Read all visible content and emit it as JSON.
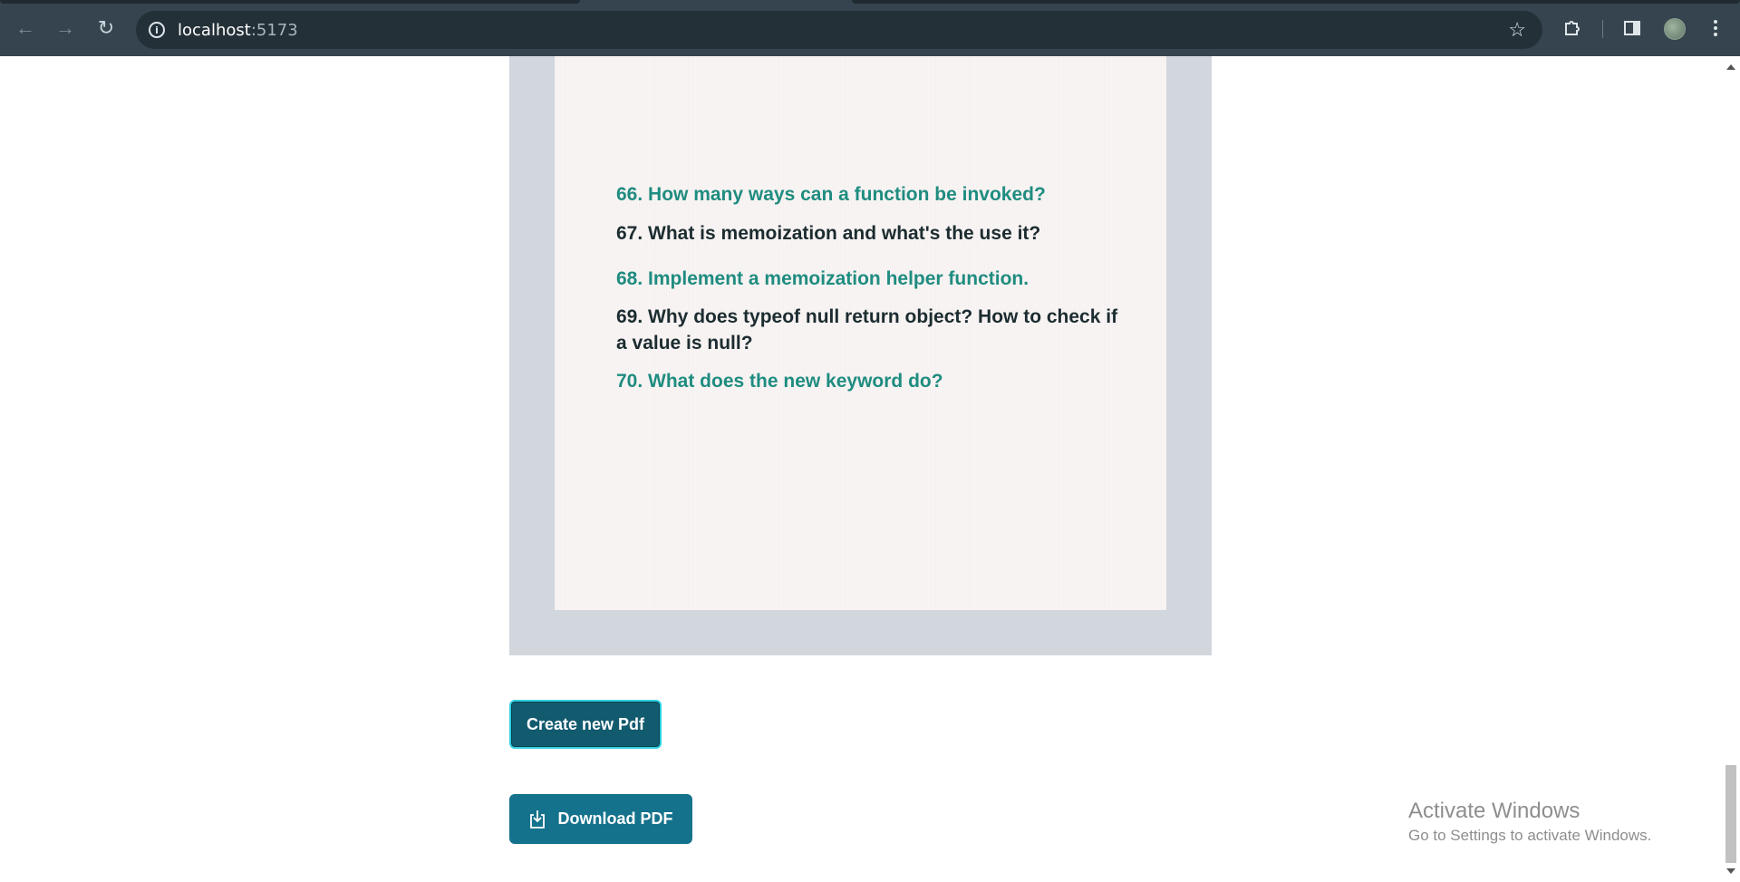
{
  "browser": {
    "url_host": "localhost",
    "url_port": ":5173",
    "icons": {
      "back": "arrow-left-icon",
      "forward": "arrow-right-icon",
      "reload": "reload-icon",
      "info": "info-icon",
      "bookmark": "star-icon",
      "extensions": "puzzle-icon",
      "side_panel": "side-panel-icon",
      "menu": "kebab-menu-icon"
    }
  },
  "pdf_preview": {
    "questions": [
      {
        "text": "66. How many ways can a function be invoked?",
        "color": "#1f8c80"
      },
      {
        "text": "67. What is memoization and what's the use it?",
        "color": "#1c2c30"
      },
      {
        "text": "68. Implement a memoization helper function.",
        "color": "#1f8c80"
      },
      {
        "text": "69. Why does typeof null return object? How to check if a value is null?",
        "color": "#1c2c30"
      },
      {
        "text": "70. What does the new keyword do?",
        "color": "#1f8c80"
      }
    ]
  },
  "actions": {
    "create_label": "Create new Pdf",
    "download_label": "Download PDF"
  },
  "watermark": {
    "title": "Activate Windows",
    "subtitle": "Go to Settings to activate Windows."
  },
  "colors": {
    "create_bg": "#125a6e",
    "create_border": "#2fd0e0",
    "download_bg": "#14728c",
    "frame_bg": "#d2d6dd"
  }
}
